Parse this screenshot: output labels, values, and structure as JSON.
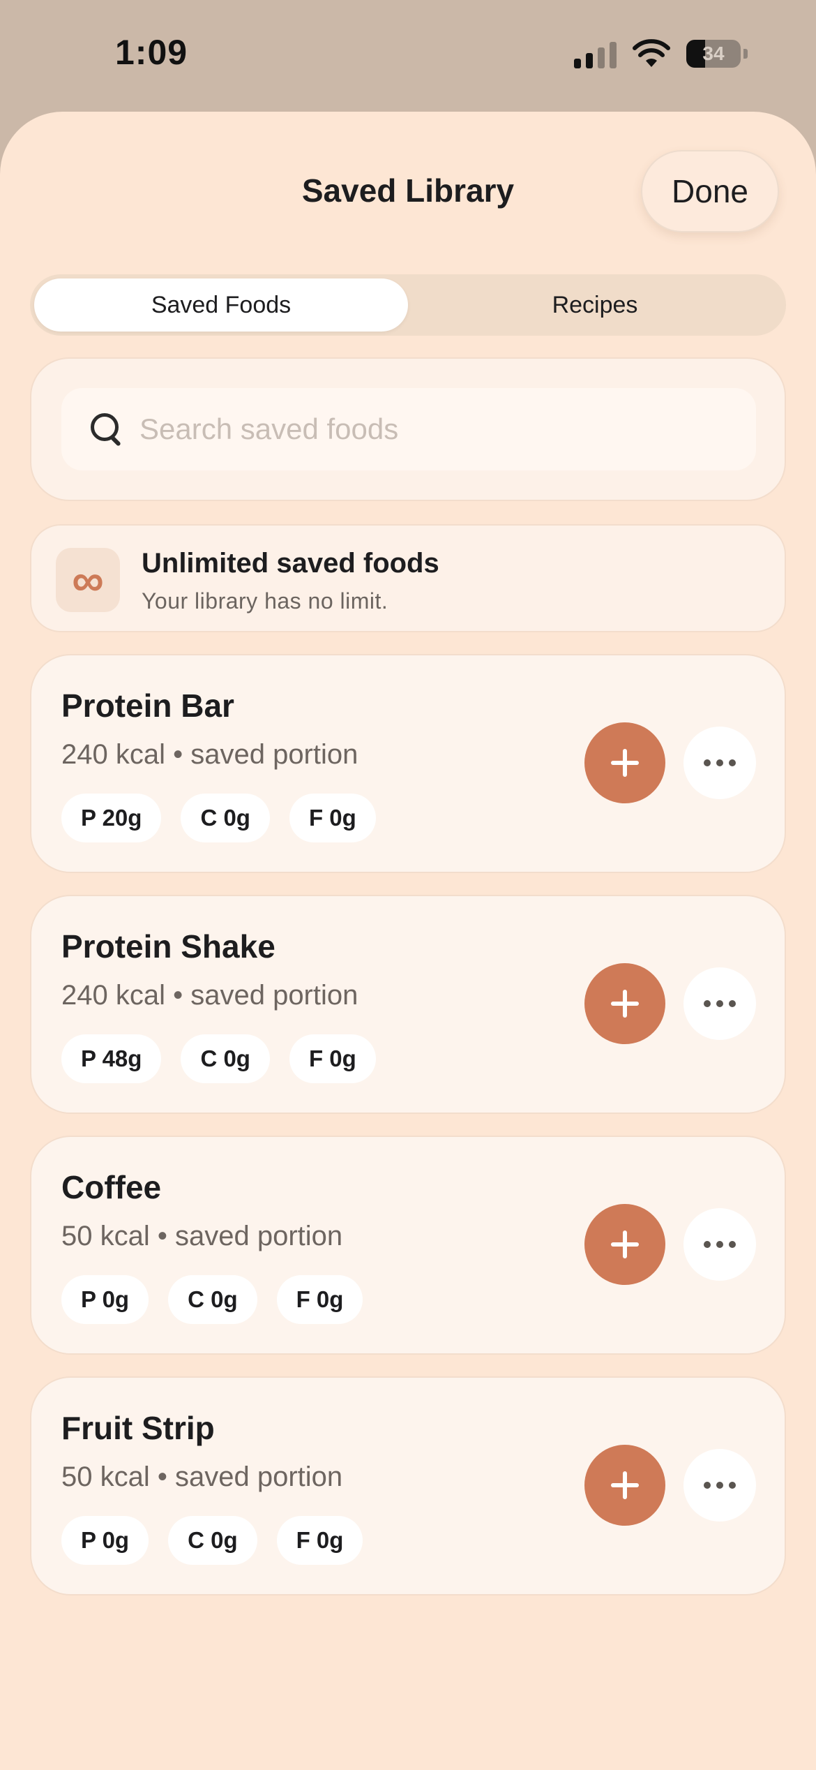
{
  "status_bar": {
    "time": "1:09",
    "battery": "34"
  },
  "header": {
    "title": "Saved Library",
    "done_label": "Done"
  },
  "tabs": [
    {
      "label": "Saved Foods",
      "active": true
    },
    {
      "label": "Recipes",
      "active": false
    }
  ],
  "search": {
    "placeholder": "Search saved foods"
  },
  "info": {
    "icon": "∞",
    "title": "Unlimited saved foods",
    "subtitle": "Your library has no limit."
  },
  "foods": [
    {
      "name": "Protein Bar",
      "meta": "240 kcal • saved portion",
      "protein": "P 20g",
      "carbs": "C 0g",
      "fat": "F 0g"
    },
    {
      "name": "Protein Shake",
      "meta": "240 kcal • saved portion",
      "protein": "P 48g",
      "carbs": "C 0g",
      "fat": "F 0g"
    },
    {
      "name": "Coffee",
      "meta": "50 kcal • saved portion",
      "protein": "P 0g",
      "carbs": "C 0g",
      "fat": "F 0g"
    },
    {
      "name": "Fruit Strip",
      "meta": "50 kcal • saved portion",
      "protein": "P 0g",
      "carbs": "C 0g",
      "fat": "F 0g"
    }
  ],
  "colors": {
    "accent": "#cf7a57",
    "sheet": "#fde6d4",
    "card": "#fdf4ed"
  }
}
